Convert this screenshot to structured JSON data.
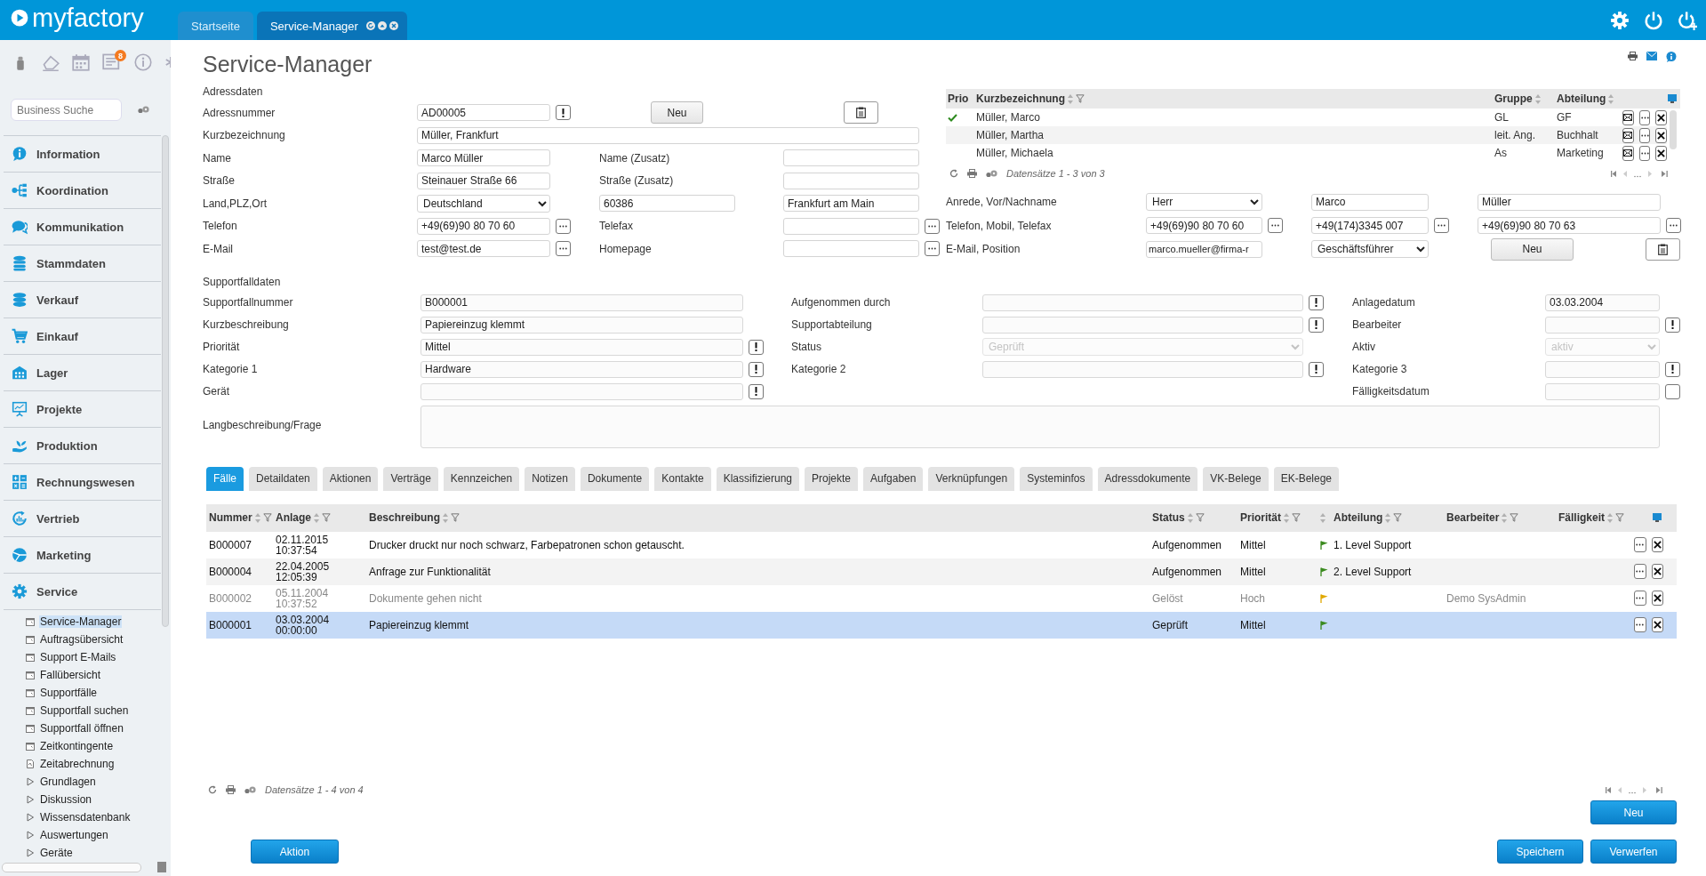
{
  "app": {
    "logo": "myfactory",
    "tabs": [
      {
        "label": "Startseite",
        "selected": false
      },
      {
        "label": "Service-Manager",
        "selected": true
      }
    ]
  },
  "sidebar": {
    "badge": "8",
    "search": {
      "placeholder": "Business Suche"
    },
    "modules": [
      {
        "label": "Information"
      },
      {
        "label": "Koordination"
      },
      {
        "label": "Kommunikation"
      },
      {
        "label": "Stammdaten"
      },
      {
        "label": "Verkauf"
      },
      {
        "label": "Einkauf"
      },
      {
        "label": "Lager"
      },
      {
        "label": "Projekte"
      },
      {
        "label": "Produktion"
      },
      {
        "label": "Rechnungswesen"
      },
      {
        "label": "Vertrieb"
      },
      {
        "label": "Marketing"
      },
      {
        "label": "Service",
        "children": [
          {
            "label": "Service-Manager",
            "kind": "page",
            "selected": true
          },
          {
            "label": "Auftragsübersicht",
            "kind": "page",
            "selected": false
          },
          {
            "label": "Support E-Mails",
            "kind": "page",
            "selected": false
          },
          {
            "label": "Fallübersicht",
            "kind": "page",
            "selected": false
          },
          {
            "label": "Supportfälle",
            "kind": "page",
            "selected": false
          },
          {
            "label": "Supportfall suchen",
            "kind": "page",
            "selected": false
          },
          {
            "label": "Supportfall öffnen",
            "kind": "page",
            "selected": false
          },
          {
            "label": "Zeitkontingente",
            "kind": "page",
            "selected": false
          },
          {
            "label": "Zeitabrechnung",
            "kind": "report",
            "selected": false
          },
          {
            "label": "Grundlagen",
            "kind": "group",
            "selected": false
          },
          {
            "label": "Diskussion",
            "kind": "group",
            "selected": false
          },
          {
            "label": "Wissensdatenbank",
            "kind": "group",
            "selected": false
          },
          {
            "label": "Auswertungen",
            "kind": "group",
            "selected": false
          },
          {
            "label": "Geräte",
            "kind": "group",
            "selected": false
          }
        ]
      }
    ]
  },
  "page": {
    "title": "Service-Manager"
  },
  "address": {
    "heading": "Adressdaten",
    "address_number": {
      "label": "Adressnummer",
      "value": "AD00005"
    },
    "new_button": "Neu",
    "short_name": {
      "label": "Kurzbezeichnung",
      "value": "Müller, Frankfurt"
    },
    "name": {
      "label": "Name",
      "value": "Marco Müller"
    },
    "name_extra": {
      "label": "Name (Zusatz)"
    },
    "street": {
      "label": "Straße",
      "value": "Steinauer Straße 66"
    },
    "street_extra": {
      "label": "Straße (Zusatz)"
    },
    "location": {
      "label": "Land,PLZ,Ort",
      "country": "Deutschland",
      "zip": "60386",
      "city": "Frankfurt am Main"
    },
    "phone": {
      "label": "Telefon",
      "value": "+49(69)90 80 70 60"
    },
    "fax": {
      "label": "Telefax"
    },
    "email": {
      "label": "E-Mail",
      "value": "test@test.de"
    },
    "homepage": {
      "label": "Homepage"
    }
  },
  "contacts": {
    "columns": [
      "Prio",
      "Kurzbezeichnung",
      "Gruppe",
      "Abteilung"
    ],
    "rows": [
      {
        "prio": true,
        "name": "Müller, Marco",
        "group": "GL",
        "department": "GF"
      },
      {
        "prio": false,
        "name": "Müller, Martha",
        "group": "leit. Ang.",
        "department": "Buchhalt"
      },
      {
        "prio": false,
        "name": "Müller, Michaela",
        "group": "As",
        "department": "Marketing"
      }
    ],
    "records": "Datensätze 1 - 3 von 3",
    "form": {
      "salutation_label": "Anrede, Vor/Nachname",
      "salutation": "Herr",
      "first_name": "Marco",
      "last_name": "Müller",
      "phone_label": "Telefon, Mobil, Telefax",
      "phone": "+49(69)90 80 70 60",
      "mobile": "+49(174)3345 007",
      "fax": "+49(69)90 80 70 63",
      "email_label": "E-Mail, Position",
      "email": "marco.mueller@firma-r",
      "position": "Geschäftsführer",
      "new_button": "Neu"
    }
  },
  "support": {
    "heading": "Supportfalldaten",
    "rows": [
      [
        {
          "label": "Supportfallnummer",
          "value": "B000001",
          "kind": "text"
        },
        {
          "label": "Aufgenommen durch",
          "kind": "text",
          "alert_button": true
        },
        {
          "label": "Anlagedatum",
          "value": "03.03.2004",
          "kind": "text"
        }
      ],
      [
        {
          "label": "Kurzbeschreibung",
          "value": "Papiereinzug klemmt",
          "kind": "text"
        },
        {
          "label": "Supportabteilung",
          "kind": "text",
          "alert_button": true
        },
        {
          "label": "Bearbeiter",
          "kind": "text",
          "alert_button": true
        }
      ],
      [
        {
          "label": "Priorität",
          "value": "Mittel",
          "kind": "text",
          "alert_button": true
        },
        {
          "label": "Status",
          "value": "Geprüft",
          "kind": "select",
          "disabled": true
        },
        {
          "label": "Aktiv",
          "value": "aktiv",
          "kind": "select",
          "disabled": true
        }
      ],
      [
        {
          "label": "Kategorie 1",
          "value": "Hardware",
          "kind": "text",
          "alert_button": true
        },
        {
          "label": "Kategorie 2",
          "kind": "text",
          "alert_button": true
        },
        {
          "label": "Kategorie 3",
          "kind": "text",
          "alert_button": true
        }
      ],
      [
        {
          "label": "Gerät",
          "kind": "text",
          "alert_button": true
        },
        {
          "kind": "empty"
        },
        {
          "label": "Fälligkeitsdatum",
          "kind": "text",
          "date_button": true
        }
      ]
    ],
    "long_description": {
      "label": "Langbeschreibung/Frage"
    }
  },
  "tabs": [
    {
      "label": "Fälle",
      "selected": true
    },
    {
      "label": "Detaildaten",
      "selected": false
    },
    {
      "label": "Aktionen",
      "selected": false
    },
    {
      "label": "Verträge",
      "selected": false
    },
    {
      "label": "Kennzeichen",
      "selected": false
    },
    {
      "label": "Notizen",
      "selected": false
    },
    {
      "label": "Dokumente",
      "selected": false
    },
    {
      "label": "Kontakte",
      "selected": false
    },
    {
      "label": "Klassifizierung",
      "selected": false
    },
    {
      "label": "Projekte",
      "selected": false
    },
    {
      "label": "Aufgaben",
      "selected": false
    },
    {
      "label": "Verknüpfungen",
      "selected": false
    },
    {
      "label": "Systeminfos",
      "selected": false
    },
    {
      "label": "Adressdokumente",
      "selected": false
    },
    {
      "label": "VK-Belege",
      "selected": false
    },
    {
      "label": "EK-Belege",
      "selected": false
    }
  ],
  "table": {
    "columns": [
      {
        "label": "Nummer",
        "kind": "text"
      },
      {
        "label": "Anlage",
        "kind": "text"
      },
      {
        "label": "Beschreibung",
        "kind": "text"
      },
      {
        "label": "Status",
        "kind": "text"
      },
      {
        "label": "Priorität",
        "kind": "text"
      },
      {
        "kind": "flag"
      },
      {
        "label": "Abteilung",
        "kind": "text"
      },
      {
        "label": "Bearbeiter",
        "kind": "text"
      },
      {
        "label": "Fälligkeit",
        "kind": "text"
      }
    ],
    "rows": [
      {
        "number": "B000007",
        "date": "02.11.2015",
        "time": "10:37:54",
        "description": "Drucker druckt nur noch schwarz, Farbepatronen schon getauscht.",
        "status": "Aufgenommen",
        "priority": "Mittel",
        "color": "#3a8a1e",
        "department": "1. Level Support",
        "muted": false,
        "selected": false
      },
      {
        "number": "B000004",
        "date": "22.04.2005",
        "time": "12:05:39",
        "description": "Anfrage zur Funktionalität",
        "status": "Aufgenommen",
        "priority": "Mittel",
        "color": "#3a8a1e",
        "department": "2. Level Support",
        "muted": false,
        "selected": false
      },
      {
        "number": "B000002",
        "date": "05.11.2004",
        "time": "10:37:52",
        "description": "Dokumente gehen nicht",
        "status": "Gelöst",
        "priority": "Hoch",
        "color": "#e0a800",
        "assignee": "Demo SysAdmin",
        "muted": true,
        "selected": false
      },
      {
        "number": "B000001",
        "date": "03.03.2004",
        "time": "00:00:00",
        "description": "Papiereinzug klemmt",
        "status": "Geprüft",
        "priority": "Mittel",
        "color": "#3a8a1e",
        "muted": false,
        "selected": true
      }
    ],
    "records": "Datensätze 1 - 4 von 4"
  },
  "buttons": {
    "new": "Neu",
    "action": "Aktion",
    "save": "Speichern",
    "discard": "Verwerfen"
  }
}
